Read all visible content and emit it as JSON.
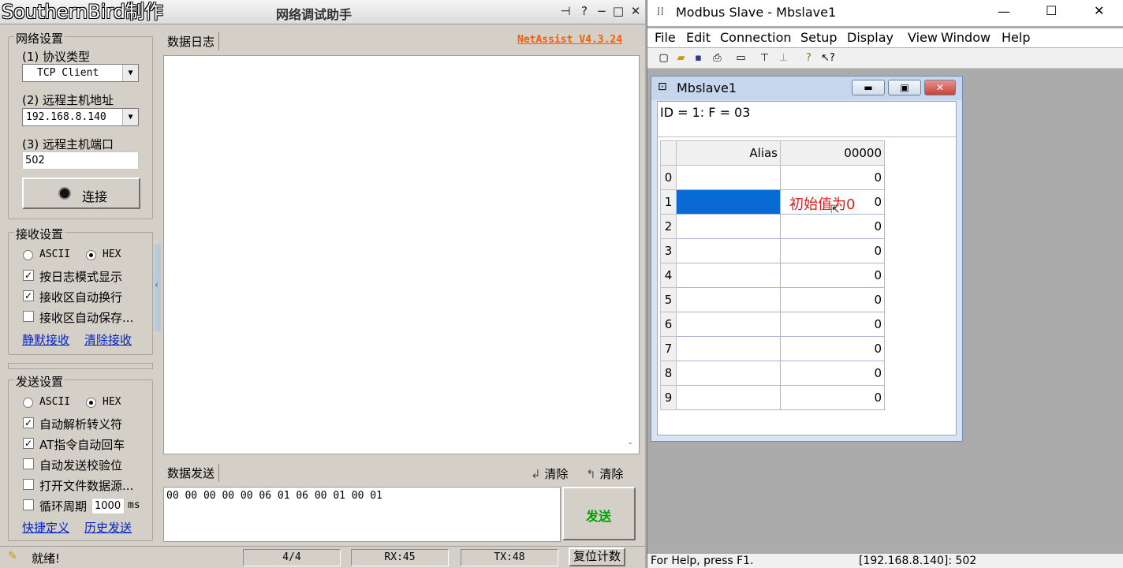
{
  "netassist": {
    "brand_overlay": "SouthernBird制作",
    "window_title": "网络调试助手",
    "version": "NetAssist V4.3.24",
    "network": {
      "group_title": "网络设置",
      "protocol_label": "(1) 协议类型",
      "protocol_value": "TCP Client",
      "host_label": "(2) 远程主机地址",
      "host_value": "192.168.8.140",
      "port_label": "(3) 远程主机端口",
      "port_value": "502",
      "connect_label": "连接"
    },
    "receive": {
      "group_title": "接收设置",
      "ascii_label": "ASCII",
      "hex_label": "HEX",
      "opt1": "按日志模式显示",
      "opt2": "接收区自动换行",
      "opt3": "接收区自动保存...",
      "link1": "静默接收",
      "link2": "清除接收"
    },
    "send": {
      "group_title": "发送设置",
      "ascii_label": "ASCII",
      "hex_label": "HEX",
      "opt1": "自动解析转义符",
      "opt2": "AT指令自动回车",
      "opt3": "自动发送校验位",
      "opt4": "打开文件数据源...",
      "opt5": "循环周期",
      "period_value": "1000",
      "period_unit": "ms",
      "link1": "快捷定义",
      "link2": "历史发送"
    },
    "log_tab": "数据日志",
    "send_tab": "数据发送",
    "clear1": "清除",
    "clear2": "清除",
    "send_data": "00 00 00 00 00 06 01 06 00 01 00 01",
    "send_button": "发送",
    "status": {
      "ready": "就绪!",
      "count": "4/4",
      "rx": "RX:45",
      "tx": "TX:48",
      "reset": "复位计数"
    }
  },
  "modbus": {
    "window_title": "Modbus Slave - Mbslave1",
    "menu": [
      "File",
      "Edit",
      "Connection",
      "Setup",
      "Display",
      "View",
      "Window",
      "Help"
    ],
    "child_title": "Mbslave1",
    "info": "ID = 1: F = 03",
    "grid": {
      "alias_header": "Alias",
      "col_header": "00000",
      "rows": [
        "0",
        "1",
        "2",
        "3",
        "4",
        "5",
        "6",
        "7",
        "8",
        "9"
      ],
      "values": [
        "0",
        "0",
        "0",
        "0",
        "0",
        "0",
        "0",
        "0",
        "0",
        "0"
      ]
    },
    "annotation": "初始值为0",
    "status_left": "For Help, press F1.",
    "status_right": "[192.168.8.140]: 502"
  }
}
